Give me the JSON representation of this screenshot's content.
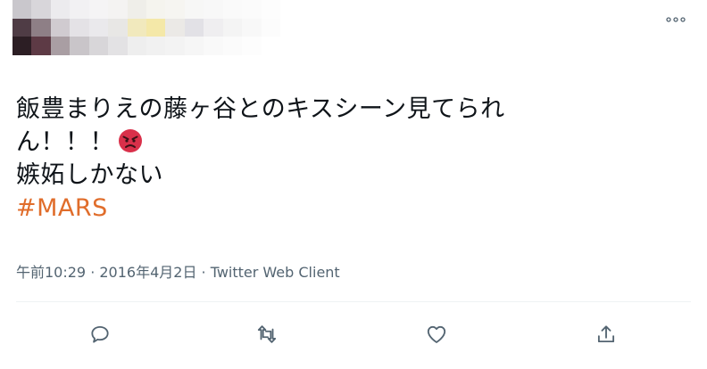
{
  "header": {
    "more_icon": "more-horizontal-icon"
  },
  "tweet": {
    "lines": [
      "飯豊まりえの藤ヶ谷とのキスシーン見てられ",
      "ん！！！",
      "嫉妬しかない"
    ],
    "emoji": "angry-face-emoji",
    "hashtag": "#MARS"
  },
  "meta": {
    "text": "午前10:29 · 2016年4月2日 · Twitter Web Client"
  },
  "actions": [
    {
      "icon": "reply-icon"
    },
    {
      "icon": "retweet-icon"
    },
    {
      "icon": "like-icon"
    },
    {
      "icon": "share-icon"
    }
  ],
  "colors": {
    "hashtag": "#e06d2b",
    "secondary_text": "#536471",
    "emoji_red": "#d9304a"
  }
}
